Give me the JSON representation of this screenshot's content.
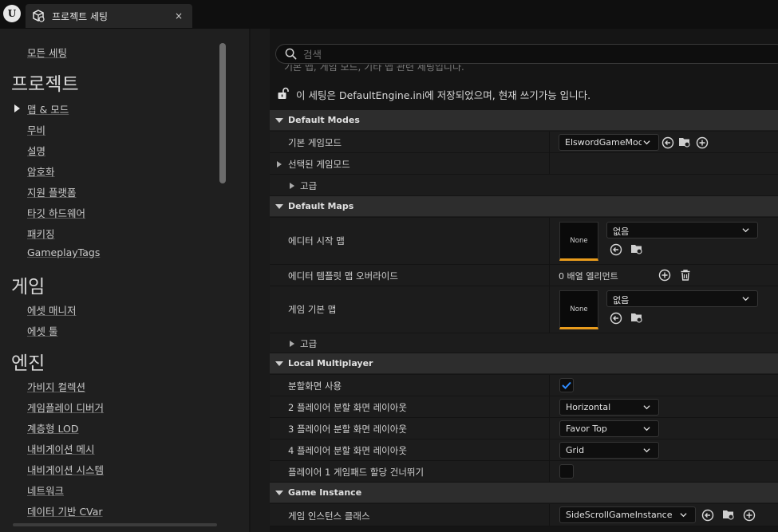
{
  "window": {
    "tab_title": "프로젝트 세팅",
    "close_glyph": "×",
    "logo_text": "U"
  },
  "sidebar": {
    "all_settings": "모든 세팅",
    "section_project": "프로젝트",
    "project_items": [
      "맵 & 모드",
      "무비",
      "설명",
      "암호화",
      "지원 플랫폼",
      "타깃 하드웨어",
      "패키징",
      "GameplayTags"
    ],
    "section_game": "게임",
    "game_items": [
      "에셋 매니저",
      "에셋 툴"
    ],
    "section_engine": "엔진",
    "engine_items": [
      "가비지 컬렉션",
      "게임플레이 디버거",
      "계층형 LOD",
      "내비게이션 메시",
      "내비게이션 시스템",
      "네트워크",
      "데이터 기반 CVar"
    ]
  },
  "main": {
    "search_placeholder": "검색",
    "description_cut": "기본 맵, 게임 모드, 기타 맵 관련 세팅입니다.",
    "config_note": "이 세팅은 DefaultEngine.ini에 저장되었으며, 현재 쓰기가능 입니다.",
    "sections": {
      "default_modes": "Default Modes",
      "default_maps": "Default Maps",
      "local_multiplayer": "Local Multiplayer",
      "game_instance": "Game Instance"
    },
    "rows": {
      "default_game_mode": {
        "label": "기본 게임모드",
        "value": "ElswordGameMod"
      },
      "selected_game_mode": {
        "label": "선택된 게임모드"
      },
      "advanced_1": {
        "label": "고급"
      },
      "editor_startup_map": {
        "label": "에디터 시작 맵",
        "thumb": "None",
        "value": "없음"
      },
      "editor_template_override": {
        "label": "에디터 템플릿 맵 오버라이드",
        "value": "0 배열 엘리먼트"
      },
      "game_default_map": {
        "label": "게임 기본 맵",
        "thumb": "None",
        "value": "없음"
      },
      "advanced_2": {
        "label": "고급"
      },
      "use_splitscreen": {
        "label": "분할화면 사용",
        "checked": true
      },
      "two_player": {
        "label": "2 플레이어 분할 화면 레이아웃",
        "value": "Horizontal"
      },
      "three_player": {
        "label": "3 플레이어 분할 화면 레이아웃",
        "value": "Favor Top"
      },
      "four_player": {
        "label": "4 플레이어 분할 화면 레이아웃",
        "value": "Grid"
      },
      "skip_gamepad": {
        "label": "플레이어 1 게임패드 할당 건너뛰기",
        "checked": false
      },
      "game_instance_class": {
        "label": "게임 인스턴스 클래스",
        "value": "SideScrollGameInstance"
      }
    }
  },
  "colors": {
    "accent_orange": "#e89b1c",
    "check_blue": "#2f8cff"
  }
}
